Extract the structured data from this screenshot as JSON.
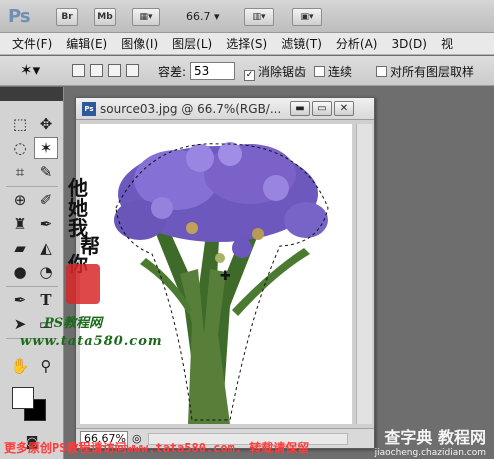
{
  "app": {
    "logo": "Ps",
    "buttons": [
      "Br",
      "Mb"
    ],
    "zoom": "66.7"
  },
  "menubar": {
    "items": [
      "文件(F)",
      "编辑(E)",
      "图像(I)",
      "图层(L)",
      "选择(S)",
      "滤镜(T)",
      "分析(A)",
      "3D(D)",
      "视"
    ]
  },
  "options": {
    "tolerance_label": "容差:",
    "tolerance_value": "53",
    "antialias_label": "消除锯齿",
    "antialias_checked": true,
    "contiguous_label": "连续",
    "contiguous_checked": false,
    "sample_all_label": "对所有图层取样",
    "sample_all_checked": false
  },
  "document": {
    "title": "source03.jpg @ 66.7%(RGB/...",
    "zoom_field": "66.67%"
  },
  "watermark": {
    "vertical_chars": [
      "他",
      "她",
      "我",
      "帮",
      "你"
    ],
    "ps_signature": "PS教程网",
    "url": "www.tata580.com",
    "banner": "更多原创PS教程请访问www.tata580.com, 转载请保留",
    "site_name": "查字典 教程网",
    "site_url": "jiaocheng.chazidian.com"
  },
  "colors": {
    "flower_purple": "#7b62c9",
    "stem_green": "#3f6b2a",
    "watermark_green": "#1a6a1a",
    "banner_red": "#ff3b3b"
  }
}
